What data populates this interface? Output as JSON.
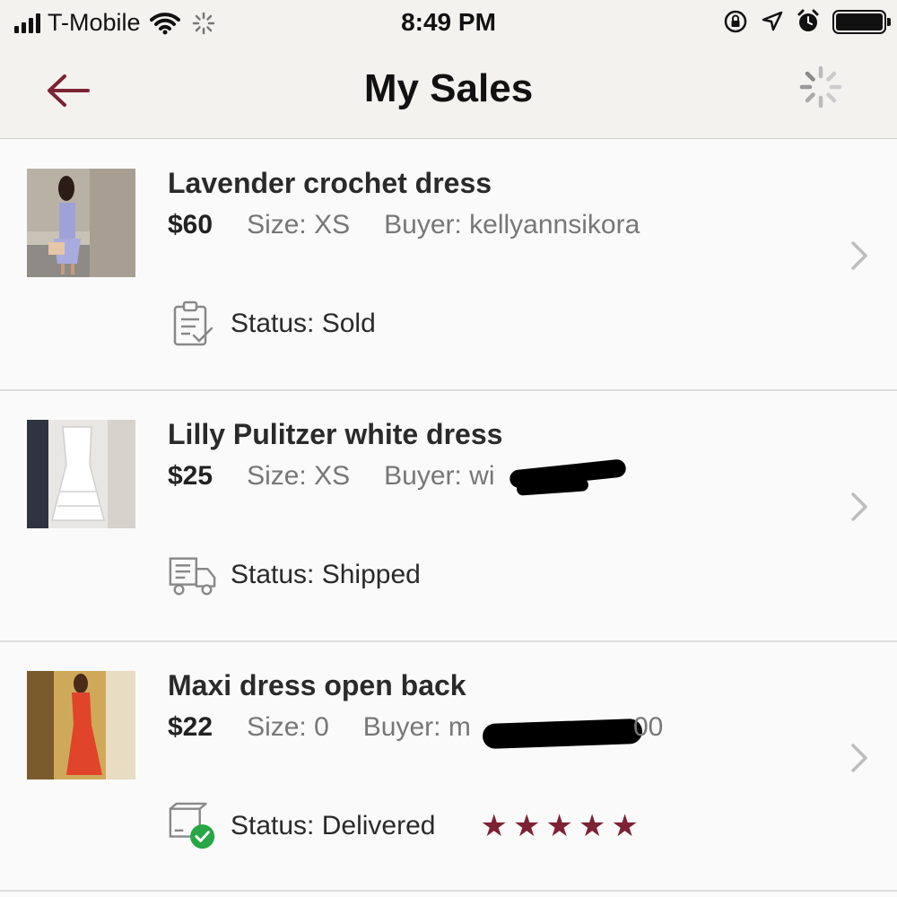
{
  "status_bar": {
    "carrier": "T-Mobile",
    "time": "8:49 PM"
  },
  "header": {
    "title": "My Sales"
  },
  "colors": {
    "accent": "#7d2233",
    "background": "#fafafa",
    "header_bg": "#f3f2ef",
    "delivered_green": "#27a745"
  },
  "sales": [
    {
      "title": "Lavender crochet dress",
      "price": "$60",
      "size": "Size: XS",
      "buyer": "Buyer: kellyannsikora",
      "status": "Status:  Sold",
      "status_icon": "clipboard-check-icon"
    },
    {
      "title": "Lilly Pulitzer white dress",
      "price": "$25",
      "size": "Size: XS",
      "buyer": "Buyer: wi",
      "status": "Status:  Shipped",
      "status_icon": "truck-icon"
    },
    {
      "title": "Maxi dress open back",
      "price": "$22",
      "size": "Size: 0",
      "buyer": "Buyer: m",
      "buyer_tail": "00",
      "status": "Status:  Delivered",
      "status_icon": "box-delivered-icon",
      "rating": 5
    }
  ]
}
